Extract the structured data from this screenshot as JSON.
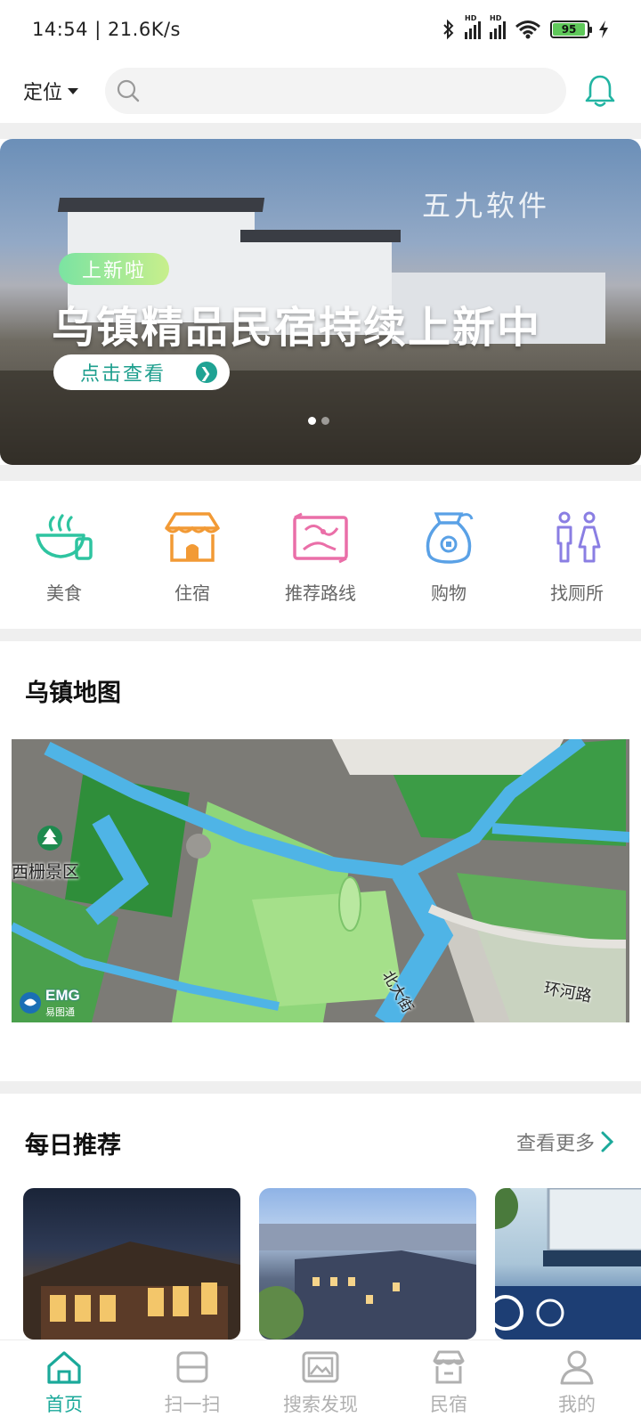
{
  "status_bar": {
    "time_speed": "14:54 | 21.6K/s",
    "battery": "95"
  },
  "header": {
    "location_label": "定位",
    "search_placeholder": ""
  },
  "banner": {
    "watermark": "五九软件",
    "tag": "上新啦",
    "headline": "乌镇精品民宿持续上新中",
    "cta": "点击查看",
    "page_count": 2,
    "active_page": 1
  },
  "categories": [
    {
      "label": "美食",
      "icon": "food-bowl-icon",
      "color": "#2ec4a0"
    },
    {
      "label": "住宿",
      "icon": "house-icon",
      "color": "#f29a35"
    },
    {
      "label": "推荐路线",
      "icon": "route-map-icon",
      "color": "#ea6fa8"
    },
    {
      "label": "购物",
      "icon": "money-bag-icon",
      "color": "#5aa1e6"
    },
    {
      "label": "找厕所",
      "icon": "restroom-icon",
      "color": "#8a7ee3"
    }
  ],
  "map_section": {
    "title": "乌镇地图",
    "labels": {
      "scenic": "西栅景区",
      "road1": "北大街",
      "road2": "环河路",
      "logo": "EMG",
      "logo_sub": "易图通"
    }
  },
  "recommend": {
    "title": "每日推荐",
    "more": "查看更多"
  },
  "tabbar": [
    {
      "label": "首页",
      "icon": "home-icon",
      "active": true
    },
    {
      "label": "扫一扫",
      "icon": "scan-icon",
      "active": false
    },
    {
      "label": "搜索发现",
      "icon": "discover-icon",
      "active": false
    },
    {
      "label": "民宿",
      "icon": "homestay-icon",
      "active": false
    },
    {
      "label": "我的",
      "icon": "profile-icon",
      "active": false
    }
  ],
  "colors": {
    "accent": "#1ba99a",
    "inactive": "#b0b0b0",
    "divider": "#efefef"
  }
}
